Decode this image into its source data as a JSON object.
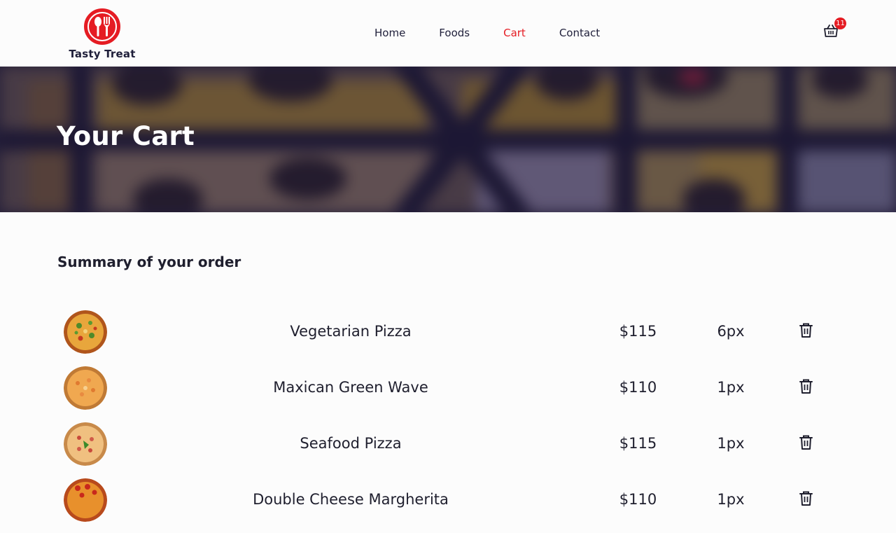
{
  "brand": {
    "name": "Tasty Treat",
    "accent_color": "#e51c23"
  },
  "nav": {
    "items": [
      {
        "label": "Home",
        "active": false
      },
      {
        "label": "Foods",
        "active": false
      },
      {
        "label": "Cart",
        "active": true
      },
      {
        "label": "Contact",
        "active": false
      }
    ]
  },
  "cart": {
    "icon": "basket-icon",
    "count": "11"
  },
  "hero": {
    "title": "Your Cart"
  },
  "summary": {
    "title": "Summary of your order",
    "items": [
      {
        "name": "Vegetarian Pizza",
        "price": "$115",
        "qty": "6px",
        "image": "vegetarian-pizza-image"
      },
      {
        "name": "Maxican Green Wave",
        "price": "$110",
        "qty": "1px",
        "image": "maxican-green-wave-image"
      },
      {
        "name": "Seafood Pizza",
        "price": "$115",
        "qty": "1px",
        "image": "seafood-pizza-image"
      },
      {
        "name": "Double Cheese Margherita",
        "price": "$110",
        "qty": "1px",
        "image": "double-cheese-margherita-image"
      }
    ]
  }
}
